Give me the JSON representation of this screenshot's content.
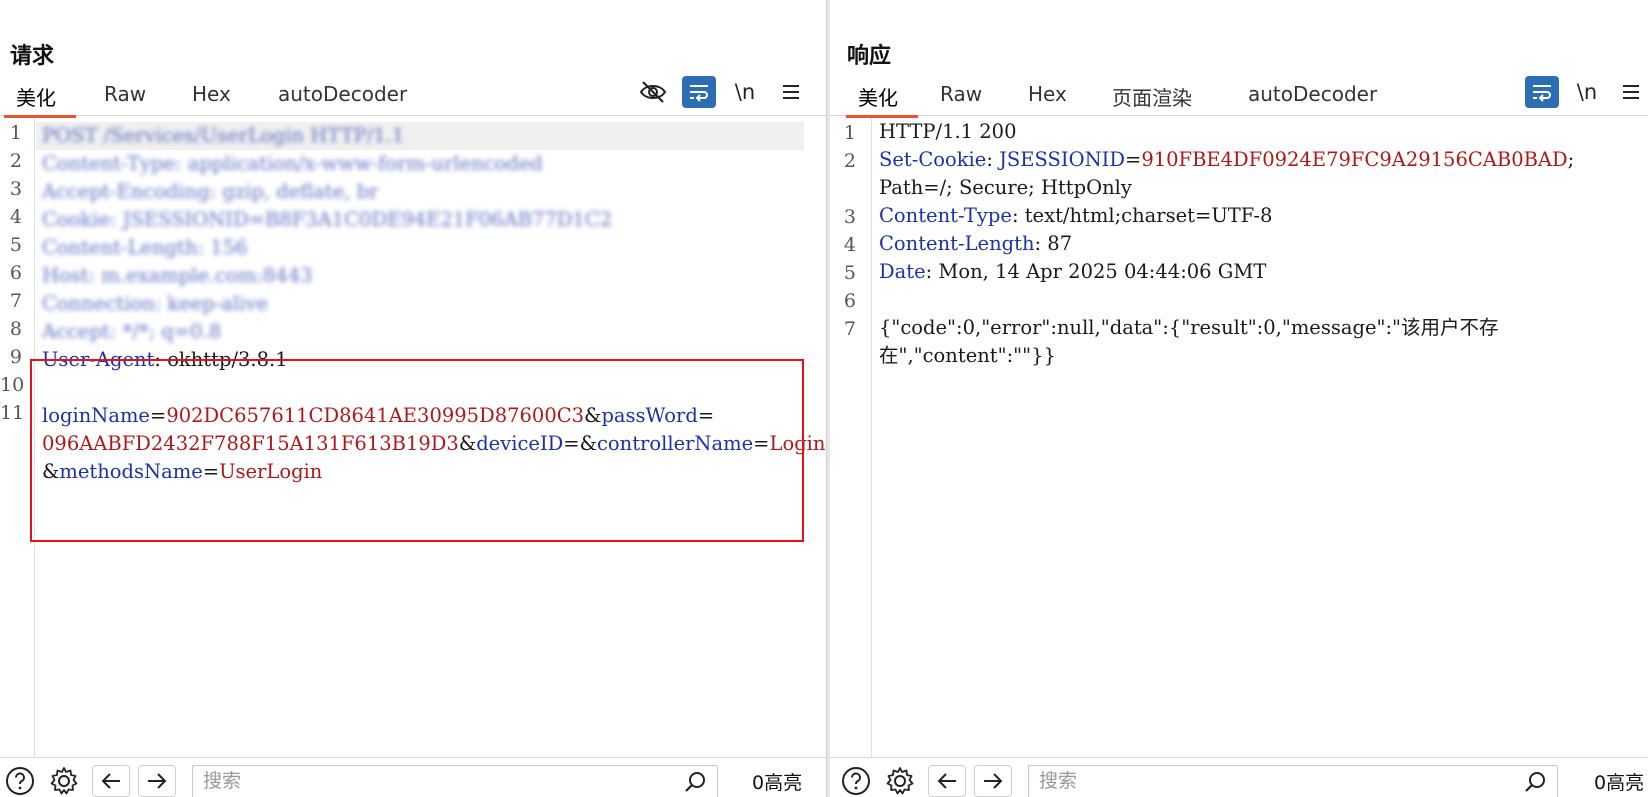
{
  "layout_switch": {
    "options": [
      "side-by-side-icon",
      "stacked-icon",
      "single-icon"
    ],
    "active": 0
  },
  "request": {
    "title": "请求",
    "tabs": [
      "美化",
      "Raw",
      "Hex",
      "autoDecoder"
    ],
    "active_tab": 0,
    "tools": {
      "newline_label": "\\n"
    },
    "lines": [
      {
        "n": "1",
        "text": "POST /Services/UserLogin HTTP/1.1"
      },
      {
        "n": "2",
        "text": "Content-Type: application/x-www-form-urlencoded"
      },
      {
        "n": "3",
        "text": "Accept-Encoding: gzip, deflate, br"
      },
      {
        "n": "4",
        "text": "Cookie: JSESSIONID=B8F3A1C0DE94E21F06AB77D1C2"
      },
      {
        "n": "5",
        "text": "Content-Length: 156"
      },
      {
        "n": "6",
        "text": "Host: m.example.com:8443"
      },
      {
        "n": "7",
        "text": "Connection: keep-alive"
      },
      {
        "n": "8",
        "text": "Accept: */*; q=0.8"
      },
      {
        "n": "9",
        "text": ""
      },
      {
        "n": "10",
        "text": ""
      },
      {
        "n": "11",
        "text": ""
      }
    ],
    "line9": {
      "key": "User-Agent",
      "sep": ": ",
      "value": "okhttp/3.8.1"
    },
    "body": {
      "row1": [
        {
          "t": "loginName",
          "c": "k"
        },
        {
          "t": "=",
          "c": "p"
        },
        {
          "t": "902DC657611CD8641AE30995D87600C3",
          "c": "v"
        },
        {
          "t": "&",
          "c": "p"
        },
        {
          "t": "passWord",
          "c": "k"
        },
        {
          "t": "=",
          "c": "p"
        }
      ],
      "row2": [
        {
          "t": "096AABFD2432F788F15A131F613B19D3",
          "c": "v"
        },
        {
          "t": "&",
          "c": "p"
        },
        {
          "t": "deviceID",
          "c": "k"
        },
        {
          "t": "=&",
          "c": "p"
        },
        {
          "t": "controllerName",
          "c": "k"
        },
        {
          "t": "=",
          "c": "p"
        },
        {
          "t": "Login",
          "c": "v"
        }
      ],
      "row3": [
        {
          "t": "&",
          "c": "p"
        },
        {
          "t": "methodsName",
          "c": "k"
        },
        {
          "t": "=",
          "c": "p"
        },
        {
          "t": "UserLogin",
          "c": "v"
        }
      ]
    },
    "footer": {
      "search_placeholder": "搜索",
      "highlight_count": "0高亮"
    }
  },
  "response": {
    "title": "响应",
    "tabs": [
      "美化",
      "Raw",
      "Hex",
      "页面渲染",
      "autoDecoder"
    ],
    "active_tab": 0,
    "tools": {
      "newline_label": "\\n"
    },
    "rows": [
      {
        "n": "1",
        "parts": [
          {
            "t": "HTTP/1.1 200",
            "c": "p"
          }
        ]
      },
      {
        "n": "2",
        "parts": [
          {
            "t": "Set-Cookie",
            "c": "k"
          },
          {
            "t": ": ",
            "c": "p"
          },
          {
            "t": "JSESSIONID",
            "c": "k"
          },
          {
            "t": "=",
            "c": "p"
          },
          {
            "t": "910FBE4DF0924E79FC9A29156CAB0BAD",
            "c": "v"
          },
          {
            "t": ";",
            "c": "p"
          }
        ]
      },
      {
        "n": "",
        "parts": [
          {
            "t": "Path=/; Secure; HttpOnly",
            "c": "p"
          }
        ]
      },
      {
        "n": "3",
        "parts": [
          {
            "t": "Content-Type",
            "c": "k"
          },
          {
            "t": ": text/html;charset=UTF-8",
            "c": "p"
          }
        ]
      },
      {
        "n": "4",
        "parts": [
          {
            "t": "Content-Length",
            "c": "k"
          },
          {
            "t": ": 87",
            "c": "p"
          }
        ]
      },
      {
        "n": "5",
        "parts": [
          {
            "t": "Date",
            "c": "k"
          },
          {
            "t": ": Mon, 14 Apr 2025 04:44:06 GMT",
            "c": "p"
          }
        ]
      },
      {
        "n": "6",
        "parts": []
      },
      {
        "n": "7",
        "parts": [
          {
            "t": "{\"code\":0,\"error\":null,\"data\":{\"result\":0,\"message\":\"该用户不存",
            "c": "p"
          }
        ]
      },
      {
        "n": "",
        "parts": [
          {
            "t": "在\",\"content\":\"\"}}",
            "c": "p"
          }
        ]
      }
    ],
    "footer": {
      "search_placeholder": "搜索",
      "highlight_count": "0高亮"
    }
  }
}
